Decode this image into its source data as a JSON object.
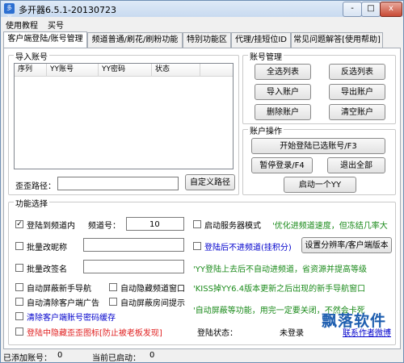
{
  "window": {
    "title": "多开器6.5.1-20130723",
    "icon_text": "多开",
    "minimize": "-",
    "maximize": "□",
    "close": "x"
  },
  "menu": [
    "使用教程",
    "买号"
  ],
  "tabs": [
    "客户端登陆/账号管理",
    "频道普通/刷花/刷粉功能",
    "特别功能区",
    "代理/挂短位ID",
    "常见问题解答[使用帮助]"
  ],
  "import_group": {
    "title": "导入账号",
    "columns": [
      "序列",
      "YY账号",
      "YY密码",
      "状态"
    ],
    "path_label": "歪歪路径：",
    "path_value": "",
    "custom_path_button": "自定义路径"
  },
  "account_mgmt": {
    "title": "账号管理",
    "buttons": [
      "全选列表",
      "反选列表",
      "导入账户",
      "导出账户",
      "删除账户",
      "清空账户"
    ]
  },
  "account_ops": {
    "title": "账户操作",
    "login_selected": "开始登陆已选账号/F3",
    "pause_login": "暂停登录/F4",
    "exit_all": "退出全部",
    "start_one": "启动一个YY"
  },
  "features": {
    "title": "功能选择",
    "login_to_channel": "登陆到频道内",
    "channel_no_label": "频道号：",
    "channel_no": "10",
    "batch_nick": "批量改昵称",
    "batch_sign": "批量改签名",
    "auto_block_guide": "自动屏蔽新手导航",
    "auto_hide_channel": "自动隐藏频道窗口",
    "auto_clear_ads": "自动清除客户端广告",
    "auto_block_room": "自动屏蔽房间提示",
    "clear_cache": "清除客户端账号密码缓存",
    "hide_yy_icon": "登陆中隐藏歪歪图标[防止被老板发现]",
    "server_mode": "启动服务器模式",
    "server_mode_hint": "'优化进频道速度，但冻结几率大",
    "no_enter_channel": "登陆后不进频道",
    "no_enter_channel_note": "(挂积分)",
    "set_resolution_button": "设置分辨率/客户端版本",
    "hint_no_channel": "'YY登陆上去后不自动进频道，省资源并提高等级",
    "hint_kiss": "'KISS掉YY6.4版本更新之后出现的新手导航窗口",
    "hint_auto_block": "'自动屏蔽等功能，用完一定要关闭，不然会卡死",
    "login_status_label": "登陆状态：",
    "login_status_value": "未登录",
    "contact_link": "联系作者微博"
  },
  "status_bar": {
    "added_label": "已添加账号：",
    "added_value": "0",
    "started_label": "当前已启动：",
    "started_value": "0"
  },
  "watermark": "飘落软件",
  "colors": {
    "hint_green": "#1a8a1a",
    "warn_red": "#e02020",
    "link_blue": "#0000cc"
  }
}
